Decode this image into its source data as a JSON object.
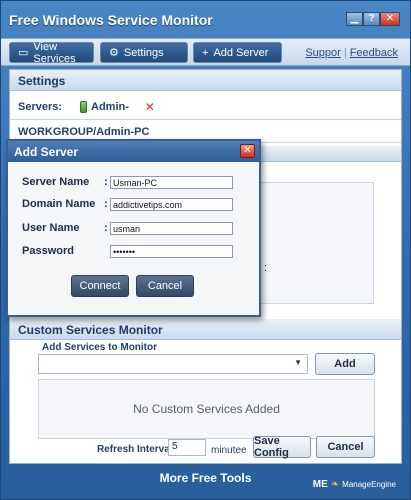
{
  "window": {
    "title": "Free Windows Service Monitor",
    "controls": {
      "minimize": "▁",
      "help": "?",
      "close": "✕"
    }
  },
  "toolbar": {
    "view_services": "View Services",
    "settings": "Settings",
    "add_server": "Add Server",
    "support": "Suppor",
    "feedback": "Feedback"
  },
  "settings": {
    "header": "Settings",
    "servers_label": "Servers:",
    "server_name": "Admin-",
    "workgroup": "WORKGROUP/Admin-PC",
    "fragment": ":"
  },
  "custom": {
    "header": "Custom Services Monitor",
    "add_label": "Add Services to Monitor",
    "add_button": "Add",
    "empty_text": "No Custom Services Added",
    "refresh_label": "Refresh Interval",
    "refresh_value": "5",
    "minutes": "minutee",
    "save_button": "Save Config",
    "cancel_button": "Cancel"
  },
  "footer": {
    "text": "More Free Tools",
    "brand_me": "ME",
    "brand_name": "ManageEngine"
  },
  "dialog": {
    "title": "Add Server",
    "close": "✕",
    "fields": [
      {
        "label": "Server Name",
        "value": "Usman-PC"
      },
      {
        "label": "Domain Name",
        "value": "addictivetips.com"
      },
      {
        "label": "User Name",
        "value": "usman"
      },
      {
        "label": "Password",
        "value": "•••••••"
      }
    ],
    "connect": "Connect",
    "cancel": "Cancel"
  },
  "icons": {
    "view_services": "monitor-icon",
    "settings": "gear-icon",
    "add_server": "plus-icon",
    "server": "server-icon",
    "remove": "close-icon",
    "dropdown": "chevron-down-icon"
  }
}
